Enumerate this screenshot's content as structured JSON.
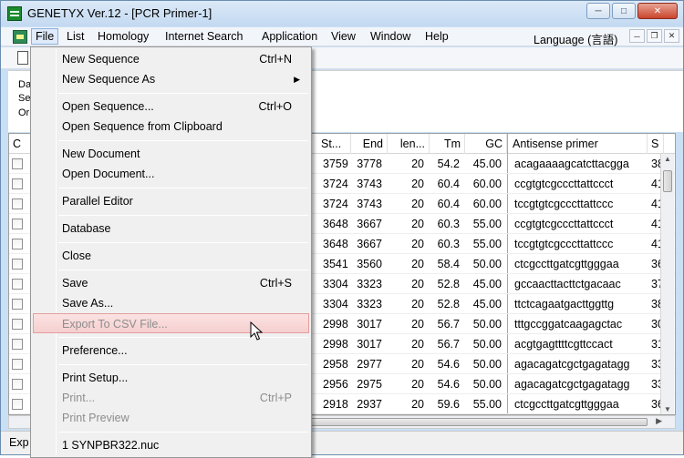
{
  "window": {
    "title": "GENETYX Ver.12 - [PCR Primer-1]",
    "controls": {
      "minimize": "─",
      "maximize": "□",
      "close": "✕"
    }
  },
  "menubar": {
    "items": [
      "File",
      "List",
      "Homology",
      "Internet Search",
      "Application",
      "View",
      "Window",
      "Help"
    ],
    "language": "Language (言語)",
    "mdi": {
      "minimize": "─",
      "restore": "❐",
      "close": "✕"
    }
  },
  "info_pane": {
    "lines": [
      "Da",
      "Se",
      "Or"
    ]
  },
  "table": {
    "headers": [
      "C",
      "St...",
      "End",
      "len...",
      "Tm",
      "GC",
      "Antisense primer",
      "S"
    ],
    "rows": [
      {
        "start": "3759",
        "end": "3778",
        "len": "20",
        "tm": "54.2",
        "gc": "45.00",
        "antisense": "acagaaaagcatcttacgga",
        "s": "38"
      },
      {
        "start": "3724",
        "end": "3743",
        "len": "20",
        "tm": "60.4",
        "gc": "60.00",
        "antisense": "ccgtgtcgcccttattccct",
        "s": "41"
      },
      {
        "start": "3724",
        "end": "3743",
        "len": "20",
        "tm": "60.4",
        "gc": "60.00",
        "antisense": "tccgtgtcgcccttattccc",
        "s": "41"
      },
      {
        "start": "3648",
        "end": "3667",
        "len": "20",
        "tm": "60.3",
        "gc": "55.00",
        "antisense": "ccgtgtcgcccttattccct",
        "s": "41"
      },
      {
        "start": "3648",
        "end": "3667",
        "len": "20",
        "tm": "60.3",
        "gc": "55.00",
        "antisense": "tccgtgtcgcccttattccc",
        "s": "41"
      },
      {
        "start": "3541",
        "end": "3560",
        "len": "20",
        "tm": "58.4",
        "gc": "50.00",
        "antisense": "ctcgccttgatcgttgggaa",
        "s": "36"
      },
      {
        "start": "3304",
        "end": "3323",
        "len": "20",
        "tm": "52.8",
        "gc": "45.00",
        "antisense": "gccaacttacttctgacaac",
        "s": "37"
      },
      {
        "start": "3304",
        "end": "3323",
        "len": "20",
        "tm": "52.8",
        "gc": "45.00",
        "antisense": "ttctcagaatgacttggttg",
        "s": "38"
      },
      {
        "start": "2998",
        "end": "3017",
        "len": "20",
        "tm": "56.7",
        "gc": "50.00",
        "antisense": "tttgccggatcaagagctac",
        "s": "30"
      },
      {
        "start": "2998",
        "end": "3017",
        "len": "20",
        "tm": "56.7",
        "gc": "50.00",
        "antisense": "acgtgagttttcgttccact",
        "s": "31"
      },
      {
        "start": "2958",
        "end": "2977",
        "len": "20",
        "tm": "54.6",
        "gc": "50.00",
        "antisense": "agacagatcgctgagatagg",
        "s": "33"
      },
      {
        "start": "2956",
        "end": "2975",
        "len": "20",
        "tm": "54.6",
        "gc": "50.00",
        "antisense": "agacagatcgctgagatagg",
        "s": "33"
      },
      {
        "start": "2918",
        "end": "2937",
        "len": "20",
        "tm": "59.6",
        "gc": "55.00",
        "antisense": "ctcgccttgatcgttgggaa",
        "s": "36"
      }
    ]
  },
  "statusbar": {
    "text": "Exp"
  },
  "file_menu": {
    "items": [
      {
        "label": "New Sequence",
        "shortcut": "Ctrl+N",
        "state": "enabled"
      },
      {
        "label": "New Sequence As",
        "submenu": "▶",
        "state": "enabled"
      },
      {
        "label": "Open Sequence...",
        "shortcut": "Ctrl+O",
        "state": "enabled"
      },
      {
        "label": "Open Sequence from Clipboard",
        "state": "enabled"
      },
      {
        "label": "New Document",
        "state": "enabled"
      },
      {
        "label": "Open Document...",
        "state": "enabled"
      },
      {
        "label": "Parallel Editor",
        "state": "enabled"
      },
      {
        "label": "Database",
        "state": "enabled"
      },
      {
        "label": "Close",
        "state": "enabled"
      },
      {
        "label": "Save",
        "shortcut": "Ctrl+S",
        "state": "enabled"
      },
      {
        "label": "Save As...",
        "state": "enabled"
      },
      {
        "label": "Export To CSV File...",
        "state": "disabled-hover"
      },
      {
        "label": "Preference...",
        "state": "enabled"
      },
      {
        "label": "Print Setup...",
        "state": "enabled"
      },
      {
        "label": "Print...",
        "shortcut": "Ctrl+P",
        "state": "disabled"
      },
      {
        "label": "Print Preview",
        "state": "disabled"
      },
      {
        "label": "1 SYNPBR322.nuc",
        "state": "enabled"
      }
    ]
  },
  "colors": {
    "hover_fill": "#f6cfcf",
    "hover_border": "#e59e9e",
    "disabled_text": "#8d8d8d",
    "app_icon": "#1a8a2e"
  }
}
